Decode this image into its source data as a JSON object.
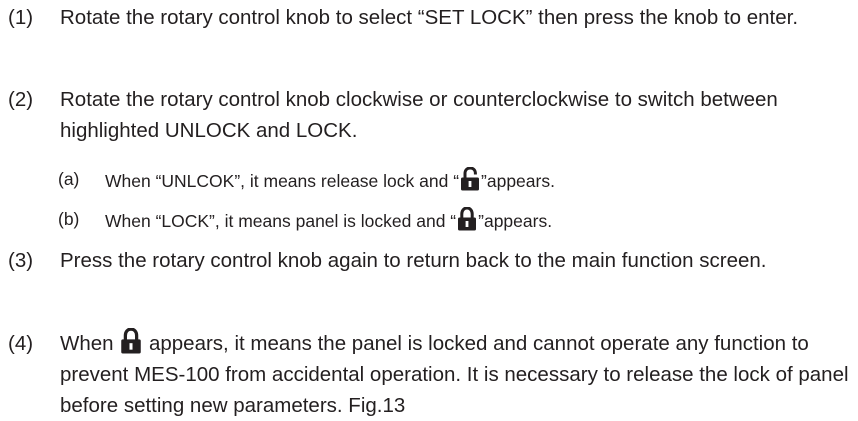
{
  "steps": [
    {
      "number": "(1)",
      "text": "Rotate the rotary control knob to select “SET LOCK” then press the knob to enter."
    },
    {
      "number": "(2)",
      "text": "Rotate the rotary control knob clockwise or counterclockwise to switch between highlighted UNLOCK and LOCK."
    },
    {
      "number": "(3)",
      "text": "Press the rotary control knob again to return back to the main function screen."
    },
    {
      "number": "(4)",
      "text_before": "When",
      "text_after": "appears, it means the panel is locked and cannot operate any function to prevent MES-100 from accidental operation. It is necessary to release the lock of panel before setting new parameters. Fig.13"
    }
  ],
  "substeps": [
    {
      "number": "(a)",
      "text_before": "When “UNLCOK”, it means release lock and “",
      "icon": "unlocked-padlock-icon",
      "text_after": "”appears."
    },
    {
      "number": "(b)",
      "text_before": "When “LOCK”, it means panel is locked and “",
      "icon": "locked-padlock-icon",
      "text_after": "”appears."
    }
  ],
  "colors": {
    "text": "#231f20"
  }
}
